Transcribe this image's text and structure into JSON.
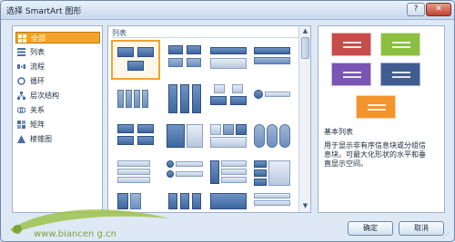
{
  "window": {
    "title": "选择 SmartArt 图形",
    "help_glyph": "?",
    "close_glyph": "✕"
  },
  "categories": [
    {
      "label": "全部",
      "icon": "all-icon",
      "selected": true
    },
    {
      "label": "列表",
      "icon": "list-icon"
    },
    {
      "label": "流程",
      "icon": "process-icon"
    },
    {
      "label": "循环",
      "icon": "cycle-icon"
    },
    {
      "label": "层次结构",
      "icon": "hierarchy-icon"
    },
    {
      "label": "关系",
      "icon": "relationship-icon"
    },
    {
      "label": "矩阵",
      "icon": "matrix-icon"
    },
    {
      "label": "棱锥图",
      "icon": "pyramid-icon"
    }
  ],
  "gallery": {
    "section_label": "列表"
  },
  "preview": {
    "colors": [
      "#c94b4b",
      "#8cbf3f",
      "#7a55b3",
      "#f3942c"
    ],
    "title": "基本列表",
    "description": "用于显示非有序信息块或分组信息块。可最大化形状的水平和垂直显示空间。"
  },
  "buttons": {
    "ok": "确定",
    "cancel": "取消"
  },
  "watermark": {
    "text": "www.biancen g.cn"
  }
}
